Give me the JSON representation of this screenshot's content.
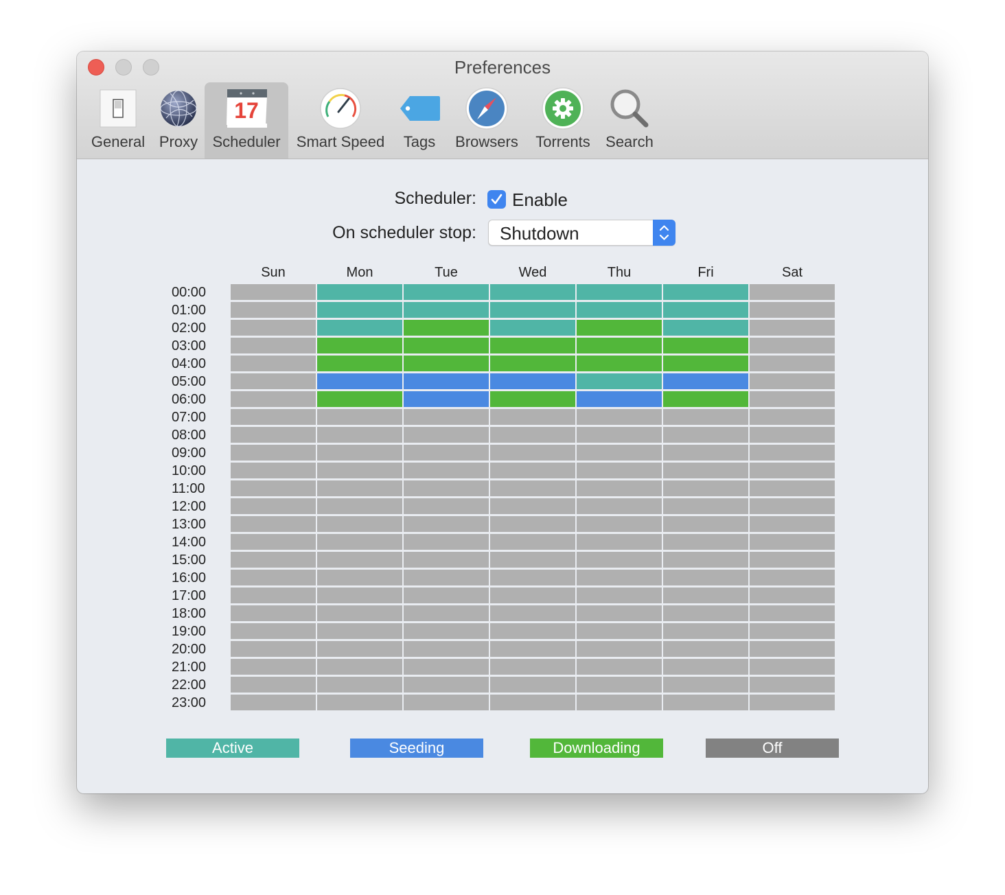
{
  "window": {
    "title": "Preferences"
  },
  "toolbar": {
    "items": [
      {
        "label": "General",
        "icon": "switch-icon",
        "selected": false
      },
      {
        "label": "Proxy",
        "icon": "globe-network-icon",
        "selected": false
      },
      {
        "label": "Scheduler",
        "icon": "calendar-icon",
        "selected": true,
        "icon_text": "17"
      },
      {
        "label": "Smart Speed",
        "icon": "speedometer-icon",
        "selected": false
      },
      {
        "label": "Tags",
        "icon": "tag-icon",
        "selected": false
      },
      {
        "label": "Browsers",
        "icon": "compass-icon",
        "selected": false
      },
      {
        "label": "Torrents",
        "icon": "gear-icon",
        "selected": false
      },
      {
        "label": "Search",
        "icon": "magnifier-icon",
        "selected": false
      }
    ]
  },
  "scheduler": {
    "label": "Scheduler:",
    "enable_label": "Enable",
    "enabled": true,
    "on_stop_label": "On scheduler stop:",
    "on_stop_value": "Shutdown"
  },
  "grid": {
    "days": [
      "Sun",
      "Mon",
      "Tue",
      "Wed",
      "Thu",
      "Fri",
      "Sat"
    ],
    "hours": [
      "00:00",
      "01:00",
      "02:00",
      "03:00",
      "04:00",
      "05:00",
      "06:00",
      "07:00",
      "08:00",
      "09:00",
      "10:00",
      "11:00",
      "12:00",
      "13:00",
      "14:00",
      "15:00",
      "16:00",
      "17:00",
      "18:00",
      "19:00",
      "20:00",
      "21:00",
      "22:00",
      "23:00"
    ],
    "schedule": {
      "Sun": [
        "off",
        "off",
        "off",
        "off",
        "off",
        "off",
        "off",
        "off",
        "off",
        "off",
        "off",
        "off",
        "off",
        "off",
        "off",
        "off",
        "off",
        "off",
        "off",
        "off",
        "off",
        "off",
        "off",
        "off"
      ],
      "Mon": [
        "active",
        "active",
        "active",
        "downloading",
        "downloading",
        "seeding",
        "downloading",
        "off",
        "off",
        "off",
        "off",
        "off",
        "off",
        "off",
        "off",
        "off",
        "off",
        "off",
        "off",
        "off",
        "off",
        "off",
        "off",
        "off"
      ],
      "Tue": [
        "active",
        "active",
        "downloading",
        "downloading",
        "downloading",
        "seeding",
        "seeding",
        "off",
        "off",
        "off",
        "off",
        "off",
        "off",
        "off",
        "off",
        "off",
        "off",
        "off",
        "off",
        "off",
        "off",
        "off",
        "off",
        "off"
      ],
      "Wed": [
        "active",
        "active",
        "active",
        "downloading",
        "downloading",
        "seeding",
        "downloading",
        "off",
        "off",
        "off",
        "off",
        "off",
        "off",
        "off",
        "off",
        "off",
        "off",
        "off",
        "off",
        "off",
        "off",
        "off",
        "off",
        "off"
      ],
      "Thu": [
        "active",
        "active",
        "downloading",
        "downloading",
        "downloading",
        "active",
        "seeding",
        "off",
        "off",
        "off",
        "off",
        "off",
        "off",
        "off",
        "off",
        "off",
        "off",
        "off",
        "off",
        "off",
        "off",
        "off",
        "off",
        "off"
      ],
      "Fri": [
        "active",
        "active",
        "active",
        "downloading",
        "downloading",
        "seeding",
        "downloading",
        "off",
        "off",
        "off",
        "off",
        "off",
        "off",
        "off",
        "off",
        "off",
        "off",
        "off",
        "off",
        "off",
        "off",
        "off",
        "off",
        "off"
      ],
      "Sat": [
        "off",
        "off",
        "off",
        "off",
        "off",
        "off",
        "off",
        "off",
        "off",
        "off",
        "off",
        "off",
        "off",
        "off",
        "off",
        "off",
        "off",
        "off",
        "off",
        "off",
        "off",
        "off",
        "off",
        "off"
      ]
    }
  },
  "state_colors": {
    "active": "#50b5a6",
    "seeding": "#4a89e1",
    "downloading": "#52b73a",
    "off": "#b0b0b0"
  },
  "legend": [
    {
      "key": "active",
      "label": "Active",
      "color": "#50b5a6"
    },
    {
      "key": "seeding",
      "label": "Seeding",
      "color": "#4a89e1"
    },
    {
      "key": "downloading",
      "label": "Downloading",
      "color": "#52b73a"
    },
    {
      "key": "off",
      "label": "Off",
      "color": "#828282"
    }
  ]
}
